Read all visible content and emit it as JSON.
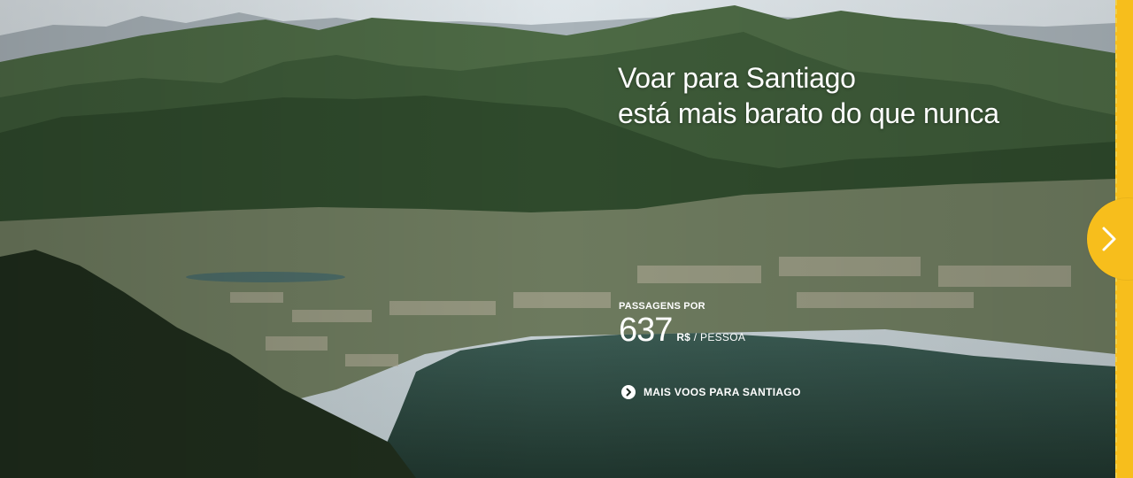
{
  "hero": {
    "headline_line1": "Voar para Santiago",
    "headline_line2": "está mais barato do que nunca",
    "price_label": "PASSAGENS POR",
    "price_value": "637",
    "price_currency": "R$",
    "price_unit": "/ PESSOA",
    "more_link_label": "MAIS VOOS PARA SANTIAGO",
    "image_subject": "aerial view of mountains, town and lake"
  },
  "icons": {
    "next": "chevron-right-icon",
    "more_link": "circle-chevron-right-icon"
  },
  "colors": {
    "accent": "#f7be1c",
    "text": "#ffffff",
    "lake": "#284238",
    "mountain": "#3d5a38"
  }
}
